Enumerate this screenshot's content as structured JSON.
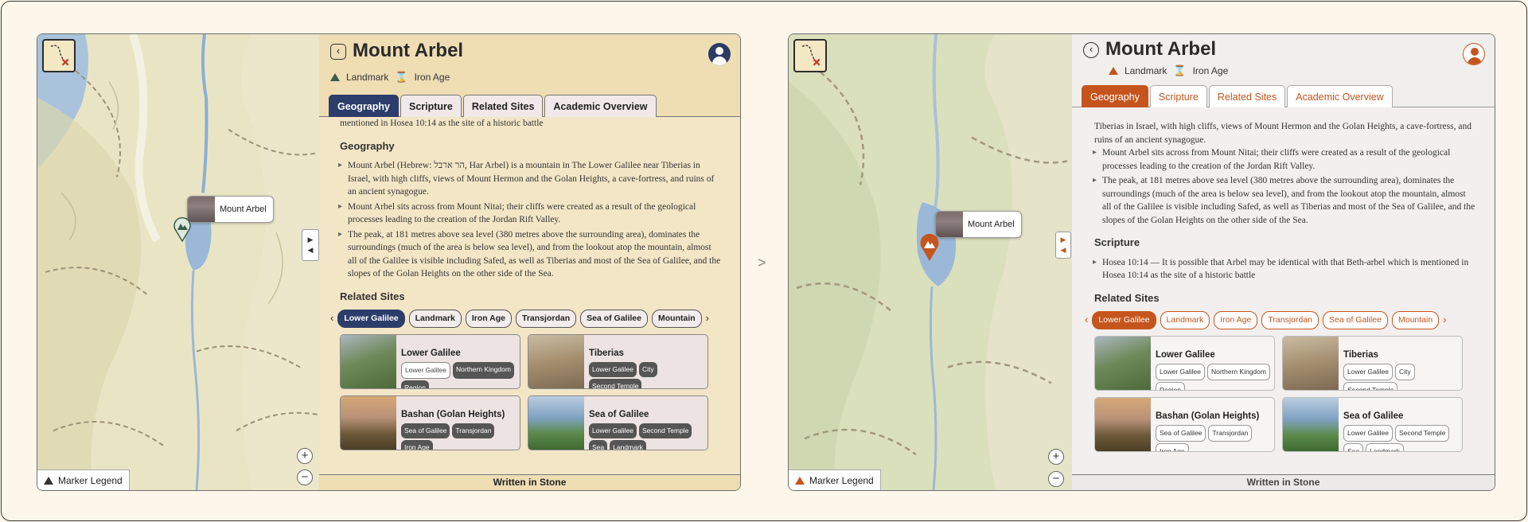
{
  "separator": ">",
  "panels": [
    {
      "map": {
        "popup_label": "Mount Arbel",
        "legend_label": "Marker Legend",
        "zoom_in": "+",
        "zoom_out": "−"
      },
      "header": {
        "back": "‹",
        "title": "Mount Arbel",
        "type_label": "Landmark",
        "era_label": "Iron Age",
        "tabs": [
          "Geography",
          "Scripture",
          "Related Sites",
          "Academic Overview"
        ]
      },
      "body": {
        "lead": "mentioned in Hosea 10:14 as the site of a historic battle",
        "geo_heading": "Geography",
        "geo_items": [
          "Mount Arbel (Hebrew: הר ארבל, Har Arbel) is a mountain in The Lower Galilee near Tiberias in Israel, with high cliffs, views of Mount Hermon and the Golan Heights, a cave-fortress, and ruins of an ancient synagogue.",
          "Mount Arbel sits across from Mount Nitai; their cliffs were created as a result of the geological processes leading to the creation of the Jordan Rift Valley.",
          "The peak, at 181 metres above sea level (380 metres above the surrounding area), dominates the surroundings (much of the area is below sea level), and from the lookout atop the mountain, almost all of the Galilee is visible including Safed, as well as Tiberias and most of the Sea of Galilee, and the slopes of the Golan Heights on the other side of the Sea."
        ],
        "related_heading": "Related Sites",
        "chips": [
          "Lower Galilee",
          "Landmark",
          "Iron Age",
          "Transjordan",
          "Sea of Galilee",
          "Mountain"
        ],
        "cards": [
          {
            "name": "Lower Galilee",
            "tags": [
              "Lower Galilee",
              "Northern Kingdom",
              "Region"
            ]
          },
          {
            "name": "Tiberias",
            "tags": [
              "Lower Galilee",
              "City",
              "Second Temple"
            ]
          },
          {
            "name": "Bashan (Golan Heights)",
            "tags": [
              "Sea of Galilee",
              "Transjordan",
              "Iron Age"
            ]
          },
          {
            "name": "Sea of Galilee",
            "tags": [
              "Lower Galilee",
              "Second Temple",
              "Sea",
              "Landmark"
            ]
          }
        ]
      },
      "footer": "Written in Stone"
    },
    {
      "map": {
        "popup_label": "Mount Arbel",
        "legend_label": "Marker Legend",
        "zoom_in": "+",
        "zoom_out": "−"
      },
      "header": {
        "back": "‹",
        "title": "Mount Arbel",
        "type_label": "Landmark",
        "era_label": "Iron Age",
        "tabs": [
          "Geography",
          "Scripture",
          "Related Sites",
          "Academic Overview"
        ]
      },
      "body": {
        "geo_items": [
          "Tiberias in Israel, with high cliffs, views of Mount Hermon and the Golan Heights, a cave-fortress, and ruins of an ancient synagogue.",
          "Mount Arbel sits across from Mount Nitai; their cliffs were created as a result of the geological processes leading to the creation of the Jordan Rift Valley.",
          "The peak, at 181 metres above sea level (380 metres above the surrounding area), dominates the surroundings (much of the area is below sea level), and from the lookout atop the mountain, almost all of the Galilee is visible including Safed, as well as Tiberias and most of the Sea of Galilee, and the slopes of the Golan Heights on the other side of the Sea."
        ],
        "scripture_heading": "Scripture",
        "scripture_item": "Hosea 10:14 — It is possible that Arbel may be identical with that Beth-arbel which is mentioned in Hosea 10:14 as the site of a historic battle",
        "related_heading": "Related Sites",
        "chips": [
          "Lower Galilee",
          "Landmark",
          "Iron Age",
          "Transjordan",
          "Sea of Galilee",
          "Mountain"
        ],
        "cards": [
          {
            "name": "Lower Galilee",
            "tags": [
              "Lower Galilee",
              "Northern Kingdom",
              "Region"
            ]
          },
          {
            "name": "Tiberias",
            "tags": [
              "Lower Galilee",
              "City",
              "Second Temple"
            ]
          },
          {
            "name": "Bashan (Golan Heights)",
            "tags": [
              "Sea of Galilee",
              "Transjordan",
              "Iron Age"
            ]
          },
          {
            "name": "Sea of Galilee",
            "tags": [
              "Lower Galilee",
              "Second Temple",
              "Sea",
              "Landmark"
            ]
          }
        ]
      },
      "footer": "Written in Stone"
    }
  ],
  "colors": {
    "left_accent": "#2c3d6b",
    "right_accent": "#c5551d",
    "left_header_bg": "#efddb4",
    "map_water": "#9bb8d8"
  }
}
